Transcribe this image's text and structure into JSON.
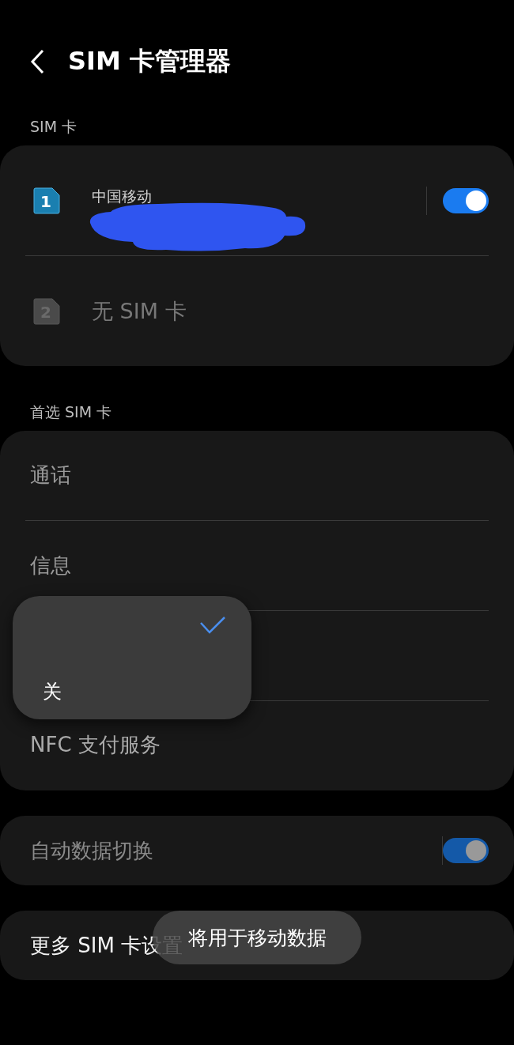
{
  "header": {
    "title": "SIM 卡管理器"
  },
  "sim_section": {
    "label": "SIM 卡",
    "cards": [
      {
        "slot": "1",
        "name": "中国移动",
        "disabled": false,
        "on": true,
        "redacted": true
      },
      {
        "slot": "2",
        "name": "无 SIM 卡",
        "disabled": true
      }
    ]
  },
  "preferred_section": {
    "label": "首选 SIM 卡",
    "items": [
      {
        "kind": "row",
        "label": "通话"
      },
      {
        "kind": "row",
        "label": "信息"
      },
      {
        "kind": "covered"
      },
      {
        "kind": "row",
        "label": "NFC 支付服务"
      }
    ]
  },
  "menu": {
    "options": [
      {
        "selected": true
      },
      {
        "label": "关",
        "selected": false
      }
    ]
  },
  "auto_switch": {
    "label": "自动数据切换",
    "on": true,
    "disabled": true
  },
  "more": {
    "label": "更多 SIM 卡设置"
  },
  "toast": {
    "text": "将用于移动数据"
  }
}
